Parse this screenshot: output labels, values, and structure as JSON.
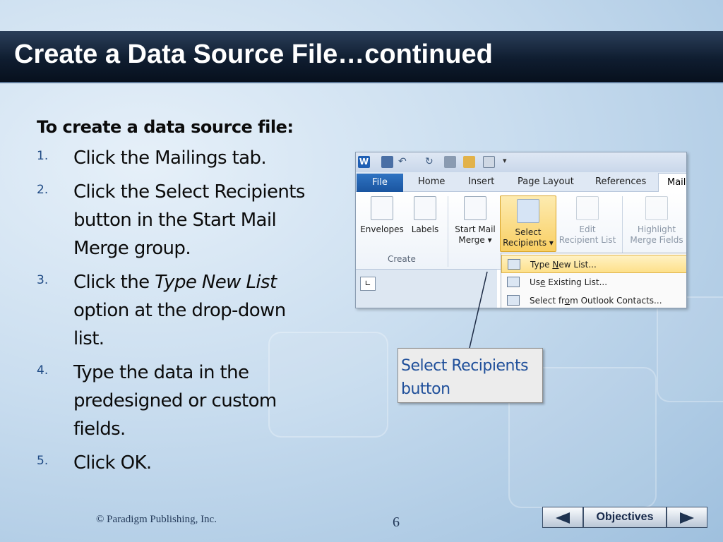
{
  "slide": {
    "title": "Create a Data Source File…continued",
    "heading": "To create a data source file:",
    "steps": [
      {
        "num": "1.",
        "text": "Click the Mailings tab."
      },
      {
        "num": "2.",
        "text": "Click the Select Recipients button in the Start Mail Merge group."
      },
      {
        "num": "3.",
        "pre": "Click the ",
        "em": "Type New List",
        "post": " option at the drop-down list."
      },
      {
        "num": "4.",
        "text": "Type the data in the predesigned or custom fields."
      },
      {
        "num": "5.",
        "text": "Click OK."
      }
    ],
    "callout": "Select Recipients button",
    "footer_copyright": "© Paradigm Publishing, Inc.",
    "page_number": "6",
    "nav": {
      "objectives_label": "Objectives",
      "prev_icon": "triangle-left-icon",
      "next_icon": "triangle-right-icon"
    }
  },
  "screenshot": {
    "tabs": {
      "file": "File",
      "home": "Home",
      "insert": "Insert",
      "page_layout": "Page Layout",
      "references": "References",
      "mailings": "Mail"
    },
    "ribbon": {
      "envelopes": "Envelopes",
      "labels": "Labels",
      "start_mail_merge_line1": "Start Mail",
      "start_mail_merge_line2": "Merge ▾",
      "select_recipients_line1": "Select",
      "select_recipients_line2": "Recipients ▾",
      "edit_recipient_line1": "Edit",
      "edit_recipient_line2": "Recipient List",
      "highlight_line1": "Highlight",
      "highlight_line2": "Merge Fields",
      "group_create": "Create"
    },
    "menu": {
      "type_new_pre": "Type ",
      "type_new_u": "N",
      "type_new_post": "ew List...",
      "use_existing_pre": "Us",
      "use_existing_u": "e",
      "use_existing_post": " Existing List...",
      "outlook_pre": "Select fr",
      "outlook_u": "o",
      "outlook_post": "m Outlook Contacts..."
    }
  }
}
